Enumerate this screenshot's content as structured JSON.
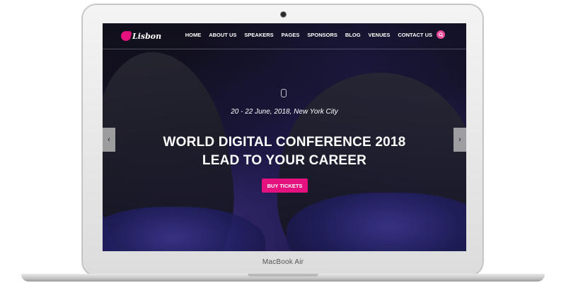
{
  "device": {
    "label": "MacBook Air"
  },
  "site": {
    "logo_text": "Lisbon",
    "nav": [
      "HOME",
      "ABOUT US",
      "SPEAKERS",
      "PAGES",
      "SPONSORS",
      "BLOG",
      "VENUES",
      "CONTACT US"
    ]
  },
  "hero": {
    "date": "20 - 22 June, 2018, New York City",
    "title_line1": "WORLD DIGITAL CONFERENCE 2018",
    "title_line2": "LEAD TO YOUR CAREER",
    "button": "BUY TICKETS",
    "prev_arrow": "‹",
    "next_arrow": "›"
  },
  "colors": {
    "accent": "#e4117f",
    "search_button": "#e94a98"
  },
  "icons": [
    "search-icon",
    "microphone-icon",
    "chevron-left-icon",
    "chevron-right-icon",
    "camera-icon"
  ]
}
